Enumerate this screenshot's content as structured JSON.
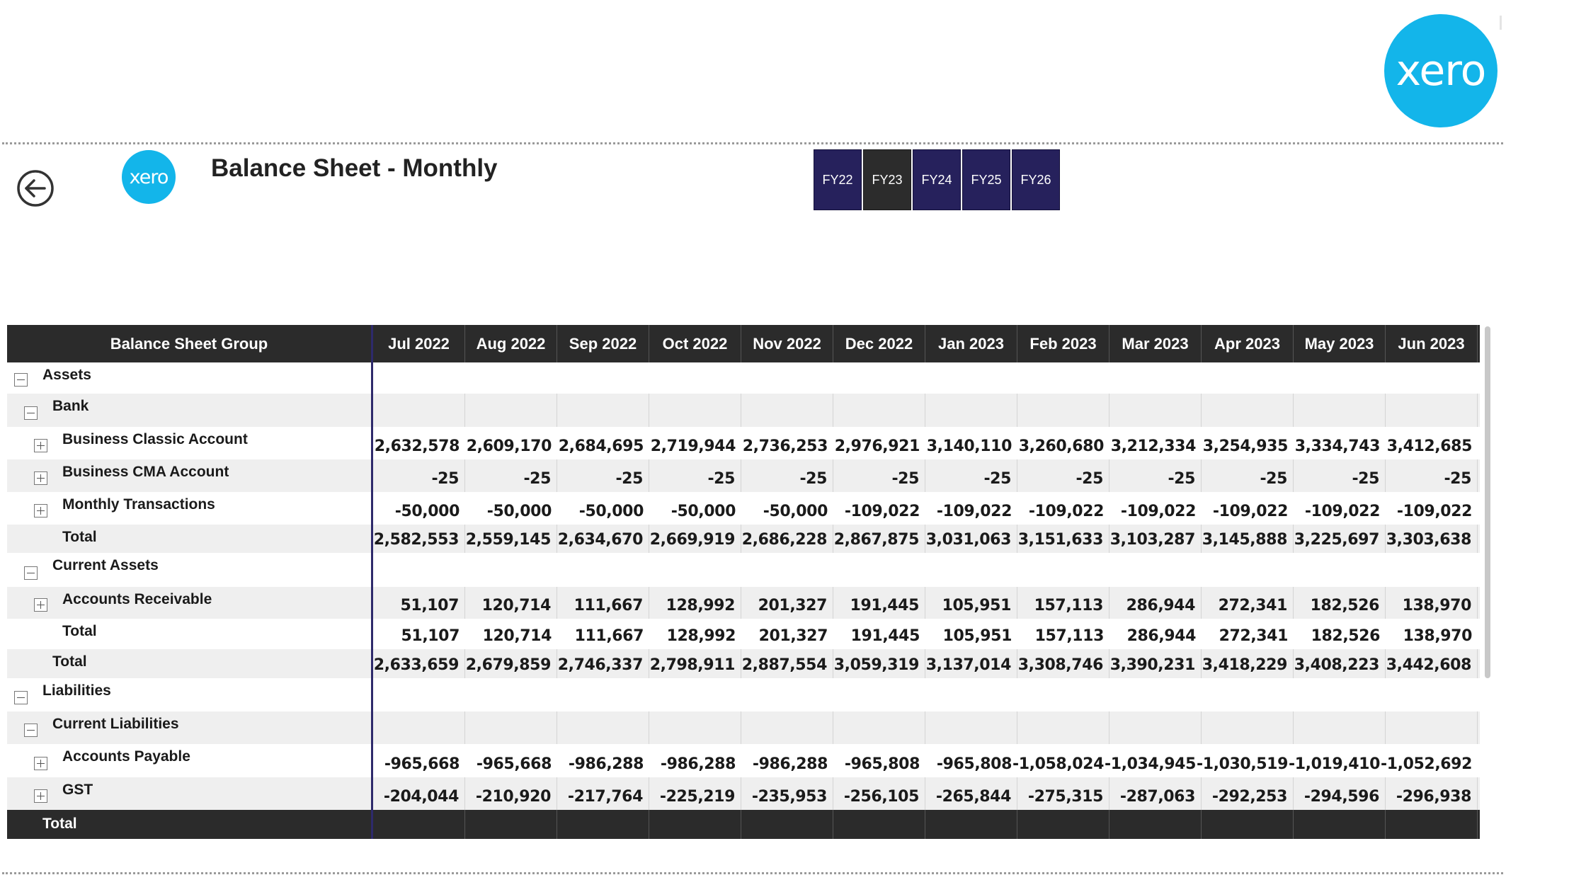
{
  "brand": {
    "logo_text": "xero",
    "color": "#13b5ea"
  },
  "page": {
    "title": "Balance Sheet - Monthly"
  },
  "fy_slicer": {
    "items": [
      "FY22",
      "FY23",
      "FY24",
      "FY25",
      "FY26"
    ],
    "selected": "FY23",
    "color": "#26215c",
    "selected_color": "#2c2c2c"
  },
  "matrix": {
    "group_header": "Balance Sheet Group",
    "columns": [
      "Jul 2022",
      "Aug 2022",
      "Sep 2022",
      "Oct 2022",
      "Nov 2022",
      "Dec 2022",
      "Jan 2023",
      "Feb 2023",
      "Mar 2023",
      "Apr 2023",
      "May 2023",
      "Jun 2023"
    ],
    "rows": [
      {
        "label": "Assets",
        "level": 0,
        "expander": "minus",
        "values": []
      },
      {
        "label": "Bank",
        "level": 1,
        "expander": "minus",
        "values": []
      },
      {
        "label": "Business Classic Account",
        "level": 2,
        "expander": "plus",
        "values": [
          "2,632,578",
          "2,609,170",
          "2,684,695",
          "2,719,944",
          "2,736,253",
          "2,976,921",
          "3,140,110",
          "3,260,680",
          "3,212,334",
          "3,254,935",
          "3,334,743",
          "3,412,685"
        ]
      },
      {
        "label": "Business CMA Account",
        "level": 2,
        "expander": "plus",
        "values": [
          "-25",
          "-25",
          "-25",
          "-25",
          "-25",
          "-25",
          "-25",
          "-25",
          "-25",
          "-25",
          "-25",
          "-25"
        ]
      },
      {
        "label": "Monthly Transactions",
        "level": 2,
        "expander": "plus",
        "values": [
          "-50,000",
          "-50,000",
          "-50,000",
          "-50,000",
          "-50,000",
          "-109,022",
          "-109,022",
          "-109,022",
          "-109,022",
          "-109,022",
          "-109,022",
          "-109,022"
        ]
      },
      {
        "label": "Total",
        "level": 2,
        "expander": "none",
        "values": [
          "2,582,553",
          "2,559,145",
          "2,634,670",
          "2,669,919",
          "2,686,228",
          "2,867,875",
          "3,031,063",
          "3,151,633",
          "3,103,287",
          "3,145,888",
          "3,225,697",
          "3,303,638"
        ]
      },
      {
        "label": "Current Assets",
        "level": 1,
        "expander": "minus",
        "values": []
      },
      {
        "label": "Accounts Receivable",
        "level": 2,
        "expander": "plus",
        "values": [
          "51,107",
          "120,714",
          "111,667",
          "128,992",
          "201,327",
          "191,445",
          "105,951",
          "157,113",
          "286,944",
          "272,341",
          "182,526",
          "138,970"
        ]
      },
      {
        "label": "Total",
        "level": 2,
        "expander": "none",
        "values": [
          "51,107",
          "120,714",
          "111,667",
          "128,992",
          "201,327",
          "191,445",
          "105,951",
          "157,113",
          "286,944",
          "272,341",
          "182,526",
          "138,970"
        ]
      },
      {
        "label": "Total",
        "level": 1,
        "expander": "none",
        "values": [
          "2,633,659",
          "2,679,859",
          "2,746,337",
          "2,798,911",
          "2,887,554",
          "3,059,319",
          "3,137,014",
          "3,308,746",
          "3,390,231",
          "3,418,229",
          "3,408,223",
          "3,442,608"
        ]
      },
      {
        "label": "Liabilities",
        "level": 0,
        "expander": "minus",
        "values": []
      },
      {
        "label": "Current Liabilities",
        "level": 1,
        "expander": "minus",
        "values": []
      },
      {
        "label": "Accounts Payable",
        "level": 2,
        "expander": "plus",
        "values": [
          "-965,668",
          "-965,668",
          "-986,288",
          "-986,288",
          "-986,288",
          "-965,808",
          "-965,808",
          "-1,058,024",
          "-1,034,945",
          "-1,030,519",
          "-1,019,410",
          "-1,052,692"
        ]
      },
      {
        "label": "GST",
        "level": 2,
        "expander": "plus",
        "values": [
          "-204,044",
          "-210,920",
          "-217,764",
          "-225,219",
          "-235,953",
          "-256,105",
          "-265,844",
          "-275,315",
          "-287,063",
          "-292,253",
          "-294,596",
          "-296,938"
        ]
      }
    ],
    "footer": {
      "label": "Total",
      "values": []
    }
  }
}
